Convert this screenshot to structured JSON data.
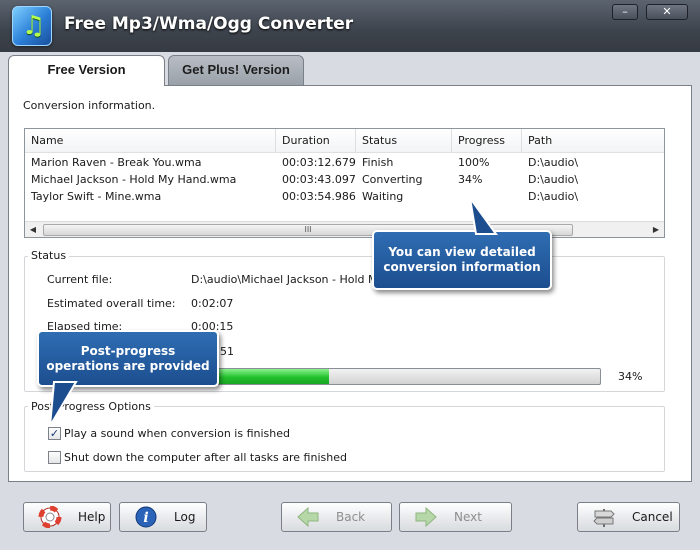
{
  "window": {
    "title": "Free Mp3/Wma/Ogg Converter",
    "minimize_glyph": "–",
    "close_glyph": "✕"
  },
  "tabs": [
    {
      "label": "Free Version",
      "active": true
    },
    {
      "label": "Get Plus! Version",
      "active": false
    }
  ],
  "conversion": {
    "heading": "Conversion information.",
    "columns": [
      "Name",
      "Duration",
      "Status",
      "Progress",
      "Path"
    ],
    "rows": [
      {
        "name": "Marion Raven - Break You.wma",
        "duration": "00:03:12.679",
        "status": "Finish",
        "progress": "100%",
        "path": "D:\\audio\\"
      },
      {
        "name": "Michael Jackson - Hold My Hand.wma",
        "duration": "00:03:43.097",
        "status": "Converting",
        "progress": "34%",
        "path": "D:\\audio\\"
      },
      {
        "name": "Taylor Swift - Mine.wma",
        "duration": "00:03:54.986",
        "status": "Waiting",
        "progress": "",
        "path": "D:\\audio\\"
      }
    ],
    "scroll_grip": "III"
  },
  "status": {
    "legend": "Status",
    "current_file_label": "Current file:",
    "current_file_value": "D:\\audio\\Michael Jackson - Hold My H",
    "estimated_label": "Estimated overall time:",
    "estimated_value": "0:02:07",
    "elapsed_label": "Elapsed time:",
    "elapsed_value": "0:00:15",
    "partial_value": "51",
    "progress_percent_text": "34%",
    "progress_fraction": 0.34
  },
  "post": {
    "legend": "Post-Progress Options",
    "play_sound_label": "Play a sound when conversion is finished",
    "play_sound_checked": true,
    "shutdown_label": "Shut down the computer after all tasks are finished",
    "shutdown_checked": false
  },
  "callouts": {
    "table_line1": "You can view detailed",
    "table_line2": "conversion information",
    "post_line1": "Post-progress",
    "post_line2": "operations are provided"
  },
  "buttons": {
    "help": "Help",
    "log": "Log",
    "back": "Back",
    "next": "Next",
    "cancel": "Cancel"
  },
  "colors": {
    "accent_blue": "#1c4e8f",
    "progress_green": "#23c12d",
    "titlebar": "#3d434c"
  }
}
